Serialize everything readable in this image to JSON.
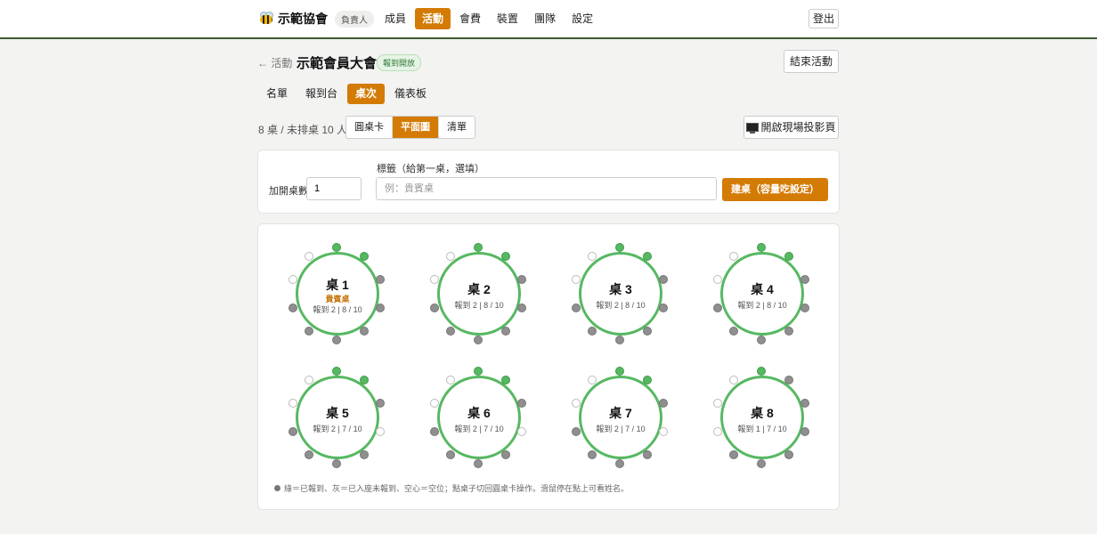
{
  "app": {
    "brand_name": "示範協會",
    "role_badge": "負責人",
    "logout": "登出"
  },
  "nav": [
    {
      "label": "成員",
      "active": false
    },
    {
      "label": "活動",
      "active": true
    },
    {
      "label": "會費",
      "active": false
    },
    {
      "label": "裝置",
      "active": false
    },
    {
      "label": "團隊",
      "active": false
    },
    {
      "label": "設定",
      "active": false
    }
  ],
  "event": {
    "back_label": "← 活動",
    "title": "示範會員大會",
    "status": "報到開放",
    "end_button": "結束活動"
  },
  "subtabs": [
    {
      "label": "名單",
      "active": false
    },
    {
      "label": "報到台",
      "active": false
    },
    {
      "label": "桌次",
      "active": true
    },
    {
      "label": "儀表板",
      "active": false
    }
  ],
  "summary": "8 桌 / 未排桌 10 人",
  "view_toggle": [
    {
      "label": "圓桌卡",
      "active": false
    },
    {
      "label": "平面圖",
      "active": true
    },
    {
      "label": "清單",
      "active": false
    }
  ],
  "projector_button": "開啟現場投影頁",
  "add_tables": {
    "count_label": "加開桌數",
    "count_value": "1",
    "tag_label": "標籤（給第一桌，選填）",
    "tag_placeholder": "例：貴賓桌",
    "submit": "建桌（容量吃設定）"
  },
  "colors": {
    "accent": "#d47b06",
    "checked_in": "#57b862",
    "seated": "#8f8f8f",
    "empty": "#ffffff"
  },
  "tables": [
    {
      "name": "桌 1",
      "tag": "貴賓桌",
      "stats": "報到 2 | 8 / 10",
      "seats": [
        "g",
        "g",
        "d",
        "d",
        "d",
        "d",
        "d",
        "d",
        "e",
        "e"
      ]
    },
    {
      "name": "桌 2",
      "tag": "",
      "stats": "報到 2 | 8 / 10",
      "seats": [
        "g",
        "g",
        "d",
        "d",
        "d",
        "d",
        "d",
        "d",
        "e",
        "e"
      ]
    },
    {
      "name": "桌 3",
      "tag": "",
      "stats": "報到 2 | 8 / 10",
      "seats": [
        "g",
        "g",
        "d",
        "d",
        "d",
        "d",
        "d",
        "d",
        "e",
        "e"
      ]
    },
    {
      "name": "桌 4",
      "tag": "",
      "stats": "報到 2 | 8 / 10",
      "seats": [
        "g",
        "g",
        "d",
        "d",
        "d",
        "d",
        "d",
        "d",
        "e",
        "e"
      ]
    },
    {
      "name": "桌 5",
      "tag": "",
      "stats": "報到 2 | 7 / 10",
      "seats": [
        "g",
        "g",
        "d",
        "e",
        "d",
        "d",
        "d",
        "d",
        "e",
        "e"
      ]
    },
    {
      "name": "桌 6",
      "tag": "",
      "stats": "報到 2 | 7 / 10",
      "seats": [
        "g",
        "g",
        "d",
        "e",
        "d",
        "d",
        "d",
        "d",
        "e",
        "e"
      ]
    },
    {
      "name": "桌 7",
      "tag": "",
      "stats": "報到 2 | 7 / 10",
      "seats": [
        "g",
        "g",
        "d",
        "e",
        "d",
        "d",
        "d",
        "d",
        "e",
        "e"
      ]
    },
    {
      "name": "桌 8",
      "tag": "",
      "stats": "報到 1 | 7 / 10",
      "seats": [
        "g",
        "d",
        "d",
        "d",
        "d",
        "d",
        "d",
        "e",
        "e",
        "e"
      ]
    }
  ],
  "legend": "綠＝已報到、灰＝已入座未報到、空心＝空位；點桌子切回圓桌卡操作。滑鼠停在點上可看姓名。"
}
